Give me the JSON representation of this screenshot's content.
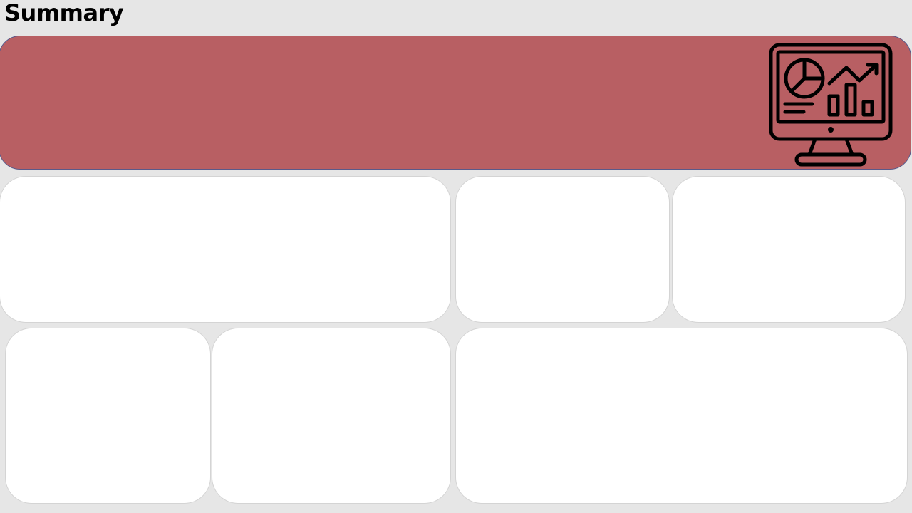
{
  "page": {
    "title": "Summary"
  },
  "colors": {
    "background": "#e6e6e6",
    "banner": "#b85f63",
    "card": "#ffffff",
    "icon_stroke": "#000000"
  },
  "banner": {
    "icon": "analytics-monitor-icon"
  },
  "cards": [
    {
      "name": "card-row1-wide"
    },
    {
      "name": "card-row1-mid"
    },
    {
      "name": "card-row1-right"
    },
    {
      "name": "card-row2-left"
    },
    {
      "name": "card-row2-mid"
    },
    {
      "name": "card-row2-wide"
    }
  ]
}
